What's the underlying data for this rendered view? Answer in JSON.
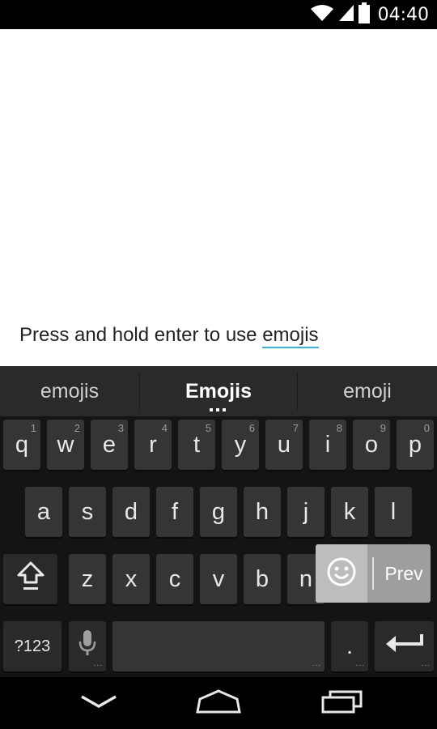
{
  "status_bar": {
    "time": "04:40",
    "icons": [
      "wifi-icon",
      "signal-icon",
      "battery-icon"
    ]
  },
  "editor": {
    "text_before": "Press and hold enter to use ",
    "composing_word": "emojis"
  },
  "keyboard": {
    "suggestions": [
      "emojis",
      "Emojis",
      "emoji"
    ],
    "row1": [
      {
        "label": "q",
        "hint": "1"
      },
      {
        "label": "w",
        "hint": "2"
      },
      {
        "label": "e",
        "hint": "3"
      },
      {
        "label": "r",
        "hint": "4"
      },
      {
        "label": "t",
        "hint": "5"
      },
      {
        "label": "y",
        "hint": "6"
      },
      {
        "label": "u",
        "hint": "7"
      },
      {
        "label": "i",
        "hint": "8"
      },
      {
        "label": "o",
        "hint": "9"
      },
      {
        "label": "p",
        "hint": "0"
      }
    ],
    "row2": [
      "a",
      "s",
      "d",
      "f",
      "g",
      "h",
      "j",
      "k",
      "l"
    ],
    "row3": [
      "z",
      "x",
      "c",
      "v",
      "b",
      "n"
    ],
    "symbols_label": "?123",
    "period_label": ".",
    "popup_prev_label": "Prev",
    "icons": {
      "shift": "shift-icon",
      "mic": "mic-icon",
      "enter": "enter-icon",
      "emoji": "smiley-icon"
    }
  },
  "nav_bar": {
    "icons": [
      "back-icon",
      "home-icon",
      "recents-icon"
    ]
  }
}
